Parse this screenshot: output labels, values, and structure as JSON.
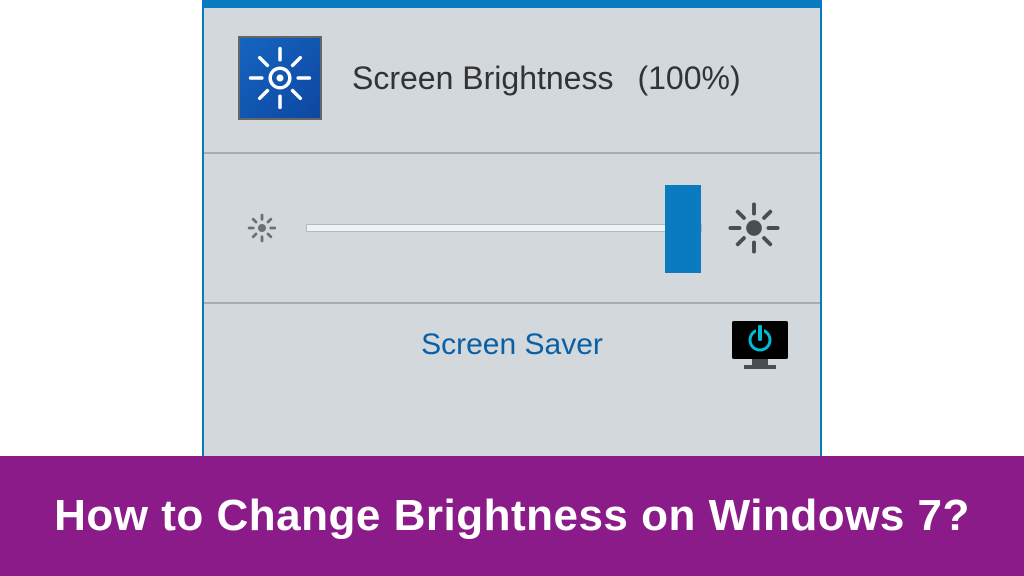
{
  "header": {
    "label": "Screen Brightness",
    "value": "(100%)"
  },
  "slider": {
    "position_percent": 100
  },
  "footer": {
    "screen_saver_label": "Screen Saver"
  },
  "caption": {
    "text": "How to Change Brightness on Windows 7?"
  },
  "colors": {
    "accent": "#0a7bc0",
    "caption_bg": "#8a1b88",
    "link": "#0a5fa5"
  }
}
